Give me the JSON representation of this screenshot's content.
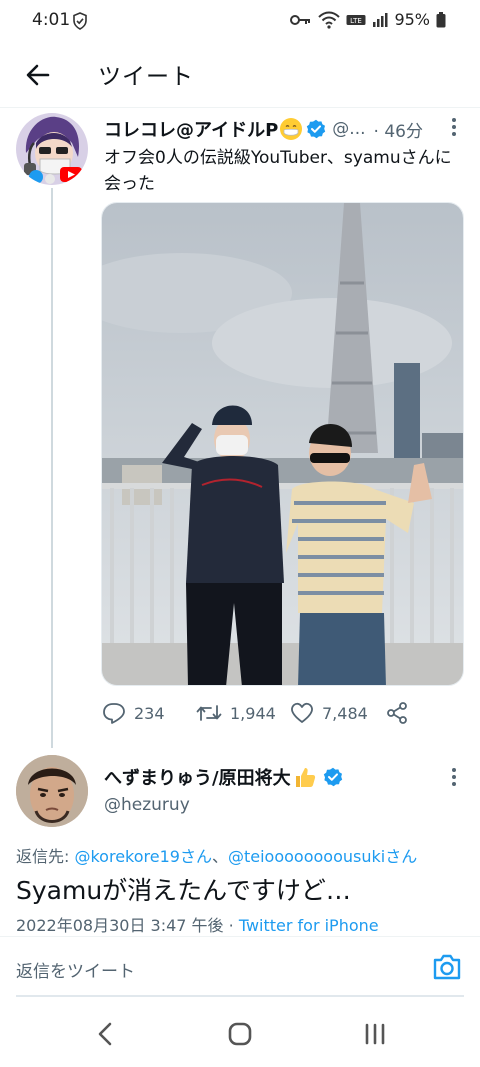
{
  "status_bar": {
    "time": "4:01",
    "battery": "95%",
    "icons": [
      "shield-icon",
      "key-icon",
      "wifi-icon",
      "volte-icon",
      "signal-icon",
      "battery-icon"
    ]
  },
  "header": {
    "back_icon": "arrow-left-icon",
    "title": "ツイート"
  },
  "tweet1": {
    "name": "コレコレ@アイドルP",
    "name_emoji": "face-with-mask-emoji",
    "handle": "@...",
    "time": "· 46分",
    "text": "オフ会0人の伝説級YouTuber、syamuさんに会った",
    "reply_count": "234",
    "retweet_count": "1,944",
    "like_count": "7,484"
  },
  "tweet2": {
    "name": "へずまりゅう/原田将大",
    "name_emoji": "thumbs-up-emoji",
    "handle": "@hezuruy",
    "reply_prefix": "返信先: ",
    "mention1": "@korekore19さん",
    "separator": "、",
    "mention2": "@teioooooooousukiさん",
    "text": "Syamuが消えたんですけど…",
    "datetime": "2022年08月30日 3:47 午後 · ",
    "source": "Twitter for iPhone"
  },
  "reply_bar": {
    "placeholder": "返信をツイート",
    "camera_icon": "camera-icon"
  },
  "colors": {
    "accent": "#1d9bf0",
    "text": "#0f1419",
    "muted": "#536471"
  }
}
